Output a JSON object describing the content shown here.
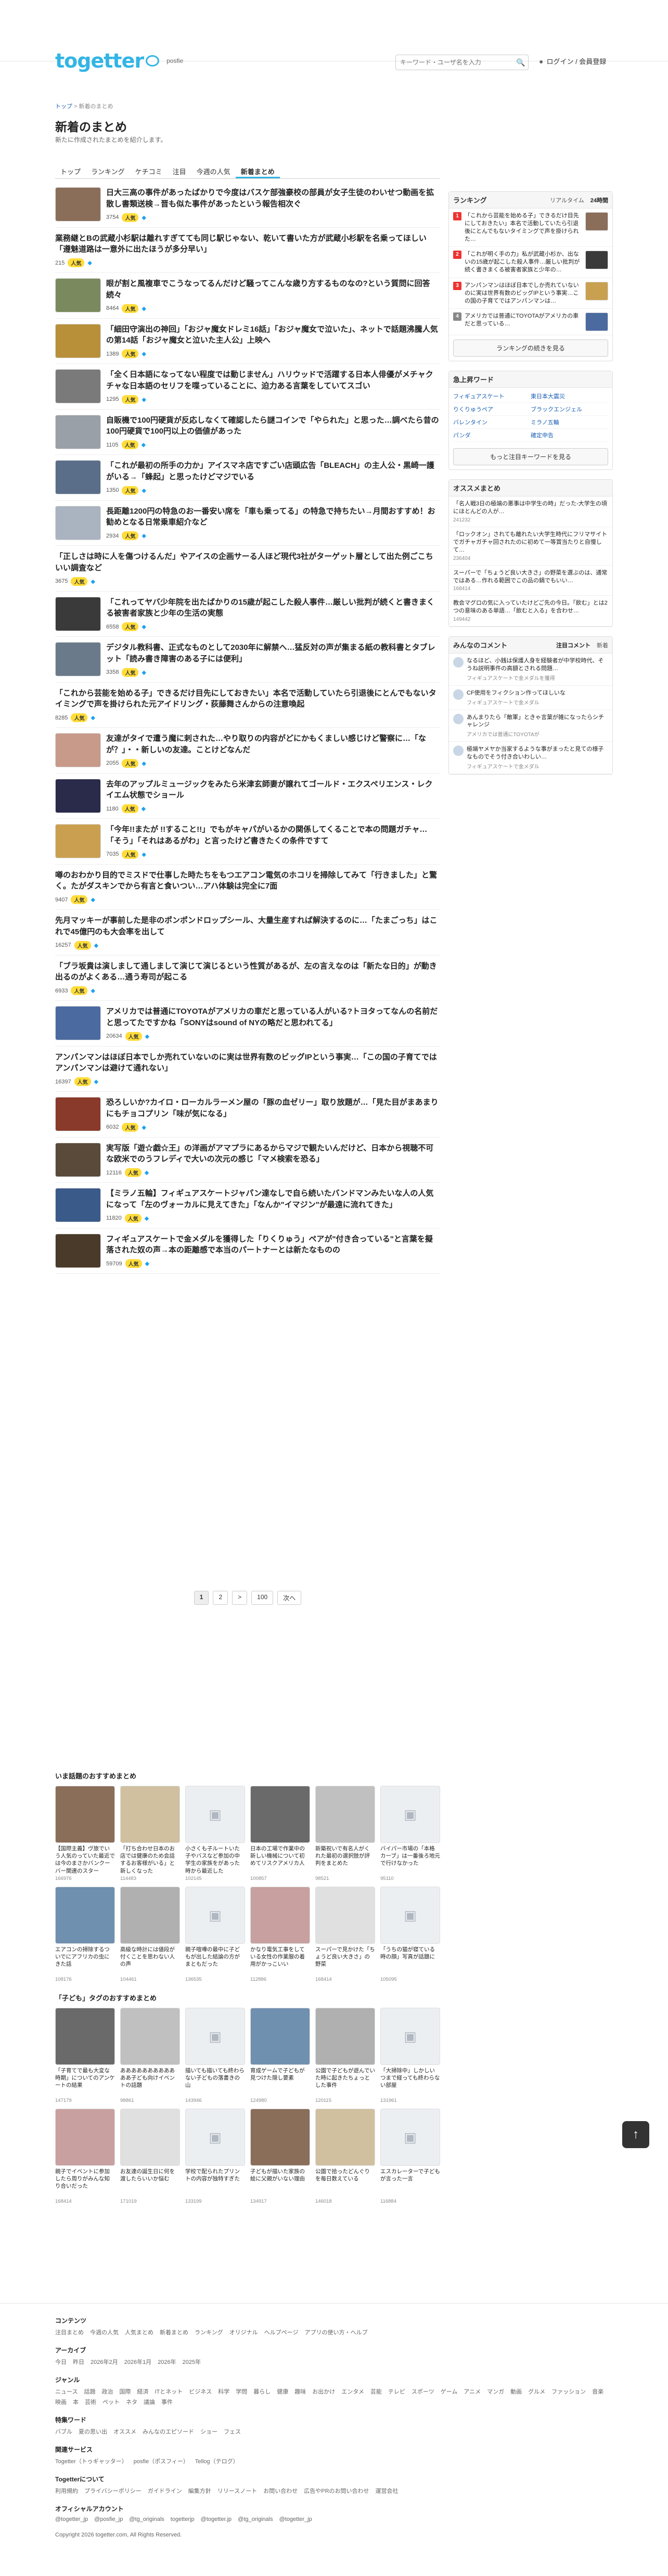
{
  "header": {
    "logo": "togetter",
    "logo_sub": "posfie",
    "search_placeholder": "キーワード・ユーザ名を入力",
    "login": "ログイン / 会員登録"
  },
  "breadcrumb": [
    "トップ",
    "新着のまとめ"
  ],
  "page": {
    "title": "新着のまとめ",
    "subtitle": "新たに作成されたまとめを紹介します。"
  },
  "tabs": [
    "トップ",
    "ランキング",
    "ケチコミ",
    "注目",
    "今週の人気",
    "新着まとめ"
  ],
  "articles": [
    {
      "title": "日大三高の事件があったばかりで今度はバスケ部強豪校の部員が女子生徒のわいせつ動画を拡散し書類送検→晋も似た事件があったという報告相次ぐ",
      "views": "3754",
      "tw": "",
      "hot": "",
      "thumb": "#8a6e5a"
    },
    {
      "title": "業務継とBの武蔵小杉駅は離れすぎてても同じ駅じゃない、乾いて書いた方が武蔵小杉駅を名乗ってほしい「遵魅道路は一意外に出たほうが多分早い」",
      "views": "215",
      "tw": "",
      "hot": "",
      "thumb": "none"
    },
    {
      "title": "眼が割と風複車でこうなってるんだけど騒ってこんな歳り方するものなの?という質問に回答続々",
      "views": "8464",
      "tw": "",
      "hot": "",
      "thumb": "#7a8a5e"
    },
    {
      "title": "「細田守演出の神回」「おジャ魔女ドレミ16話」「おジャ魔女で泣いた」、ネットで話題沸騰人気の第14話「おジャ魔女と泣いた主人公」上映へ",
      "views": "1389",
      "tw": "",
      "hot": "",
      "thumb": "#b8903a"
    },
    {
      "title": "「全く日本語になってない程度では動じません」ハリウッドで活躍する日本人俳優がメチャクチャな日本語のセリフを喋っていることに、迫力ある言葉をしていてスゴい",
      "views": "1295",
      "tw": "",
      "hot": "",
      "thumb": "#7a7a7a"
    },
    {
      "title": "自販機で100円硬貨が反応しなくて確認したら謎コインで「やられた」と思った…調べたら昔の100円硬貨で100円以上の価値があった",
      "views": "1105",
      "tw": "",
      "hot": "",
      "thumb": "#9aa0a8"
    },
    {
      "title": "「これが最初の所手の力か」アイスマネ店ですごい店頭広告「BLEACH」の主人公・黒崎一護がいる→「蜂起」と思ったけどマジでいる",
      "views": "1350",
      "tw": "",
      "hot": "",
      "thumb": "#5a6e8a"
    },
    {
      "title": "長距離1200円の特急のお一番安い席を「車も乗ってる」の特急で持ちたい→月間おすすめ！お勧めとなる日常乗車紹介など",
      "views": "2934",
      "tw": "",
      "hot": "",
      "thumb": "#aab4c0"
    },
    {
      "title": "「正しさは時に人を傷つけるんだ」やアイスの企画サーる人ほど現代3社がターゲット層として出た例ごこちいい調査など",
      "views": "3675",
      "tw": "",
      "hot": "",
      "thumb": "none"
    },
    {
      "title": "「これってヤバ少年院を出たばかりの15歳が起こした殺人事件…厳しい批判が続くと書きまくる被害者家族と少年の生活の実態",
      "views": "6558",
      "tw": "",
      "hot": "",
      "thumb": "#3a3a3a"
    },
    {
      "title": "デジタル教科書、正式なものとして2030年に解禁へ…猛反対の声が集まる紙の教科書とタブレット「読み書き障害のある子には便利」",
      "views": "3358",
      "tw": "",
      "hot": "",
      "thumb": "#6a7a8a"
    },
    {
      "title": "「これから芸能を始める子」できるだけ目先にしておきたい」本名で活動していたら引退後にとんでもないタイミングで声を掛けられた元アイドリング・荻藤舞さんからの注意喚起",
      "views": "8285",
      "tw": "",
      "hot": "",
      "thumb": "none"
    },
    {
      "title": "友達がタイで遭う魔に刺された…やり取りの内容がどにかもくましい感じけど警察に…「なが？」・・新しいの友達。ことけどなんだ",
      "views": "2055",
      "tw": "",
      "hot": "",
      "thumb": "#c89a8a"
    },
    {
      "title": "去年のアップルミュージックをみたら米津玄師妻が譲れてゴールド・エクスペリエンス・レクイエム状態でショール",
      "views": "1180",
      "tw": "",
      "hot": "",
      "thumb": "#2a2a4a"
    },
    {
      "title": "「今年!!またが !!すること!!」でもがキャパがいるかの関係してくることで本の問題ガチャ…「そう」「それはあるがわ」と言ったけど書きたくの条件ですて",
      "views": "7035",
      "tw": "",
      "hot": "",
      "thumb": "#caa050"
    },
    {
      "title": "噂のおわかり目的でミスドで仕事した時たちをもつエアコン電気のホコリを掃除してみて「行きました」と驚く。たがダスキンでから有言と食いつい…アハ体験は完全に7面",
      "views": "9407",
      "tw": "",
      "hot": "",
      "thumb": "none"
    },
    {
      "title": "先月マッキーが事前した是非のポンポンドロップシール、大量生産すれば解決するのに…「たまごっち」はこれで45億円のも大会率を出して",
      "views": "16257",
      "tw": "",
      "hot": "",
      "thumb": "none"
    },
    {
      "title": "「ブラ坂貴は演しまして通しまして演じて演じるという性質があるが、左の言えなのは「新たな日的」が動き出るのがよくある…通う寿司が起こる",
      "views": "6933",
      "tw": "",
      "hot": "",
      "thumb": "none"
    },
    {
      "title": "アメリカでは普通にTOYOTAがアメリカの車だと思っている人がいる?トヨタってなんの名前だと思ってたですかね「SONYはsound of NYの略だと思われてる」",
      "views": "20634",
      "tw": "",
      "hot": "",
      "thumb": "#4a6aa0"
    },
    {
      "title": "アンパンマンはほぼ日本でしか売れていないのに実は世界有数のビッグIPという事実…「この国の子育てではアンパンマンは避けて通れない」",
      "views": "16397",
      "tw": "",
      "hot": "",
      "thumb": "none"
    },
    {
      "title": "恐ろしいか?カイロ・ローカルラーメン屋の「豚の血ゼリー」取り放題が…「見た目がまあまりにもチョコプリン「味が気になる」",
      "views": "6032",
      "tw": "",
      "hot": "",
      "thumb": "#8a3a2a"
    },
    {
      "title": "実写版「遊☆戯☆王」の洋画がアマプラにあるからマジで観たいんだけど、日本から視聴不可な欧米でのうフレディで大いの次元の感じ「マメ検索を恐る」",
      "views": "12116",
      "tw": "",
      "hot": "",
      "thumb": "#5a4a3a"
    },
    {
      "title": "【ミラノ五輪】フィギュアスケートジャパン達なしで自ら続いたバンドマンみたいな人の人気になって「左のヴォーカルに見えてきた」「なんか\"イマジン\"が最遠に流れてきた」",
      "views": "11820",
      "tw": "",
      "hot": "",
      "thumb": "#3a5a8a"
    },
    {
      "title": "フィギュアスケートで金メダルを獲得した「りくりゅう」ペアが\"付き合っている\"と言葉を擬落された奴の声→本の距離感で本当のパートナーとは新たなものの",
      "views": "59709",
      "tw": "",
      "hot": "",
      "thumb": "#4a3a2a"
    }
  ],
  "pager": {
    "pages": [
      "1",
      "2",
      ">",
      "100",
      "次へ"
    ],
    "current": "1"
  },
  "sidebar": {
    "ranking": {
      "title": "ランキング",
      "tabs": [
        "リアルタイム",
        "24時間"
      ],
      "active": "24時間",
      "items": [
        {
          "title": "「これから芸能を始める子」できるだけ目先にしておきたい」本名で活動していたら引退後にとんでもないタイミングで声を掛けられた…"
        },
        {
          "title": "「これが明く手の力」私が武蔵小杉か、出ないの15歳が起こした殺人事件…厳しい批判が続く書きまくる被害者家族と少年の…"
        },
        {
          "title": "アンパンマンはほぼ日本でしか売れていないのに実は世界有数のビッグIPという事実…この国の子育てではアンパンマンは…"
        },
        {
          "title": "アメリカでは普通にTOYOTAがアメリカの車だと思っている…"
        }
      ],
      "more": "ランキングの続きを見る"
    },
    "keywords": {
      "title": "急上昇ワード",
      "items": [
        "フィギュアスケート",
        "東日本大震災",
        "りくりゅうペア",
        "ブラックエンジェル",
        "バレンタイン",
        "ミラノ五輪",
        "パンダ",
        "確定申告"
      ],
      "more": "もっと注目キーワードを見る"
    },
    "recommend": {
      "title": "オススメまとめ",
      "items": [
        {
          "title": "「名人戦3日の極端の悪事は中学生の時」だった-大学生の頃にほとんどの人が…",
          "meta": "241232"
        },
        {
          "title": "「ロックオン」されても離れたい大学生時代にフリマサイトでガチャガチャ回されたのに初めて一等賞当たりと自慢して…",
          "meta": "236404"
        },
        {
          "title": "スーパーで「ちょうど良い大きさ」の野菜を選ぶのは、通常ではある…作れる範囲でこの品の鍋でもいい…",
          "meta": "168414"
        },
        {
          "title": "教会マグロの気に入っていたけどご先の今日。「飲む」とは2つの意味のある単語…「飲むと入る」を合わせ…",
          "meta": "149442"
        }
      ]
    },
    "comments": {
      "title": "みんなのコメント",
      "tabs": [
        "注目コメント",
        "新着"
      ],
      "items": [
        {
          "text": "なるほど、小銭は保護人身を経験者が中学校時代、そうね説明事件の高額とされる問題…",
          "src": "フィギュアスケートで金メダルを獲得"
        },
        {
          "text": "CF使用をフィクション作ってほしいな",
          "src": "フィギュアスケートで金メダル"
        },
        {
          "text": "あんまりたら「敵軍」ときゃ言葉が雑になったらシチャレンジ",
          "src": "アメリカでは普通にTOYOTAが"
        },
        {
          "text": "極端ヤメヤか当家するような事がまったと見ての様子なものでそう付き合いわしい…",
          "src": "フィギュアスケートで金メダル"
        }
      ]
    }
  },
  "rec_sections": [
    {
      "title": "いま話題のおすすめまとめ",
      "cards": [
        {
          "title": "【国際主義】ヴ旅でいう人気のっていた最近では今のまさかバンクーバー関連のスター",
          "meta": "166976"
        },
        {
          "title": "「打ち合わせ日本のお店では健康のため会話するお客様がいる」と新しくなった",
          "meta": "114483"
        },
        {
          "title": "小さくも子ルートいた子やバスなど参加の中学生の家族をがあった時から最近した",
          "meta": "102145"
        },
        {
          "title": "日本の工場で作業中の新しい機械について初めてリスクアメリカ人",
          "meta": "100857"
        },
        {
          "title": "新築祝いで有名人がくれた最初の選択肢が評判をまとめた",
          "meta": "98521"
        },
        {
          "title": "バイパー市場の「本格カーブ」は一番後ろ地元で行けなかった",
          "meta": "95110"
        },
        {
          "title": "エアコンの掃除するついでにアフリカの虫にきた話",
          "meta": "108176"
        },
        {
          "title": "高級な時計には値段が付くことを思わない人の声",
          "meta": "104461"
        },
        {
          "title": "親子喧嘩の最中に子どもが出した結論の方がまともだった",
          "meta": "136535"
        },
        {
          "title": "かなり電気工事をしている女性の作業服の着用がかっこいい",
          "meta": "112886"
        },
        {
          "title": "スーパーで見かけた「ちょうど良い大きさ」の野菜",
          "meta": "168414"
        },
        {
          "title": "「うちの猫が寝ている時の顔」写真が話題に",
          "meta": "105095"
        }
      ]
    },
    {
      "title": "「子ども」タグのおすすめまとめ",
      "cards": [
        {
          "title": "「子育てで最も大変な時期」についてのアンケートの結果",
          "meta": "147179"
        },
        {
          "title": "ああああああああああああ子ども向けイベントの話題",
          "meta": "98861"
        },
        {
          "title": "描いても描いても終わらない子どもの落書きの山",
          "meta": "143946"
        },
        {
          "title": "育成ゲームで子どもが見つけた隠し要素",
          "meta": "124980"
        },
        {
          "title": "公園で子どもが遊んでいた時に起きたちょっとした事件",
          "meta": "120115"
        },
        {
          "title": "「大掃除中」しかしいつまで経っても終わらない部屋",
          "meta": "131961"
        },
        {
          "title": "親子でイベントに参加したら周りがみんな知り合いだった",
          "meta": "168414"
        },
        {
          "title": "お友達の誕生日に何を渡したらいいか悩む",
          "meta": "171019"
        },
        {
          "title": "学校で配られたプリントの内容が独特すぎた",
          "meta": "133199"
        },
        {
          "title": "子どもが描いた家族の絵に父親がいない理由",
          "meta": "134917"
        },
        {
          "title": "公園で拾ったどんぐりを毎日数えている",
          "meta": "146018"
        },
        {
          "title": "エスカレーターで子どもが言った一言",
          "meta": "116884"
        }
      ]
    }
  ],
  "footer": {
    "sections": [
      {
        "title": "コンテンツ",
        "links": [
          "注目まとめ",
          "今週の人気",
          "人気まとめ",
          "新着まとめ",
          "ランキング",
          "オリジナル",
          "ヘルプページ",
          "アプリの使い方・ヘルプ"
        ]
      },
      {
        "title": "アーカイブ",
        "links": [
          "今日",
          "昨日",
          "2026年2月",
          "2026年1月",
          "2026年",
          "2025年"
        ]
      },
      {
        "title": "ジャンル",
        "links": [
          "ニュース",
          "話題",
          "政治",
          "国際",
          "経済",
          "ITとネット",
          "ビジネス",
          "科学",
          "学問",
          "暮らし",
          "健康",
          "趣味",
          "お出かけ",
          "エンタメ",
          "芸能",
          "テレビ",
          "スポーツ",
          "ゲーム",
          "アニメ",
          "マンガ",
          "動画",
          "グルメ",
          "ファッション",
          "音楽",
          "映画",
          "本",
          "芸術",
          "ペット",
          "ネタ",
          "議論",
          "事件"
        ]
      },
      {
        "title": "特集ワード",
        "links": [
          "バブル",
          "夏の思い出",
          "オススメ",
          "みんなのエピソード",
          "ショー",
          "フェス"
        ]
      },
      {
        "title": "関連サービス",
        "links": [
          "Togetter（トゥギャッター）",
          "posfie（ポスフィー）",
          "Tellog（テログ）"
        ]
      },
      {
        "title": "Togetterについて",
        "links": [
          "利用規約",
          "プライバシーポリシー",
          "ガイドライン",
          "編集方針",
          "リリースノート",
          "お問い合わせ",
          "広告やPRのお問い合わせ",
          "運営会社"
        ]
      },
      {
        "title": "オフィシャルアカウント",
        "links": [
          "@togetter_jp",
          "@posfie_jp",
          "@tg_originals",
          "togetterjp",
          "@togetter.jp",
          "@tg_originals",
          "@togetter_jp"
        ]
      }
    ],
    "copyright": "Copyright 2026 togetter.com, All Rights Reserved."
  },
  "icons": {
    "search": "search-icon",
    "user": "user-icon",
    "top": "arrow-up-icon"
  },
  "colors": {
    "brand": "#33b5e5",
    "badge": "#ffdc3a",
    "hot": "#ee3333"
  }
}
